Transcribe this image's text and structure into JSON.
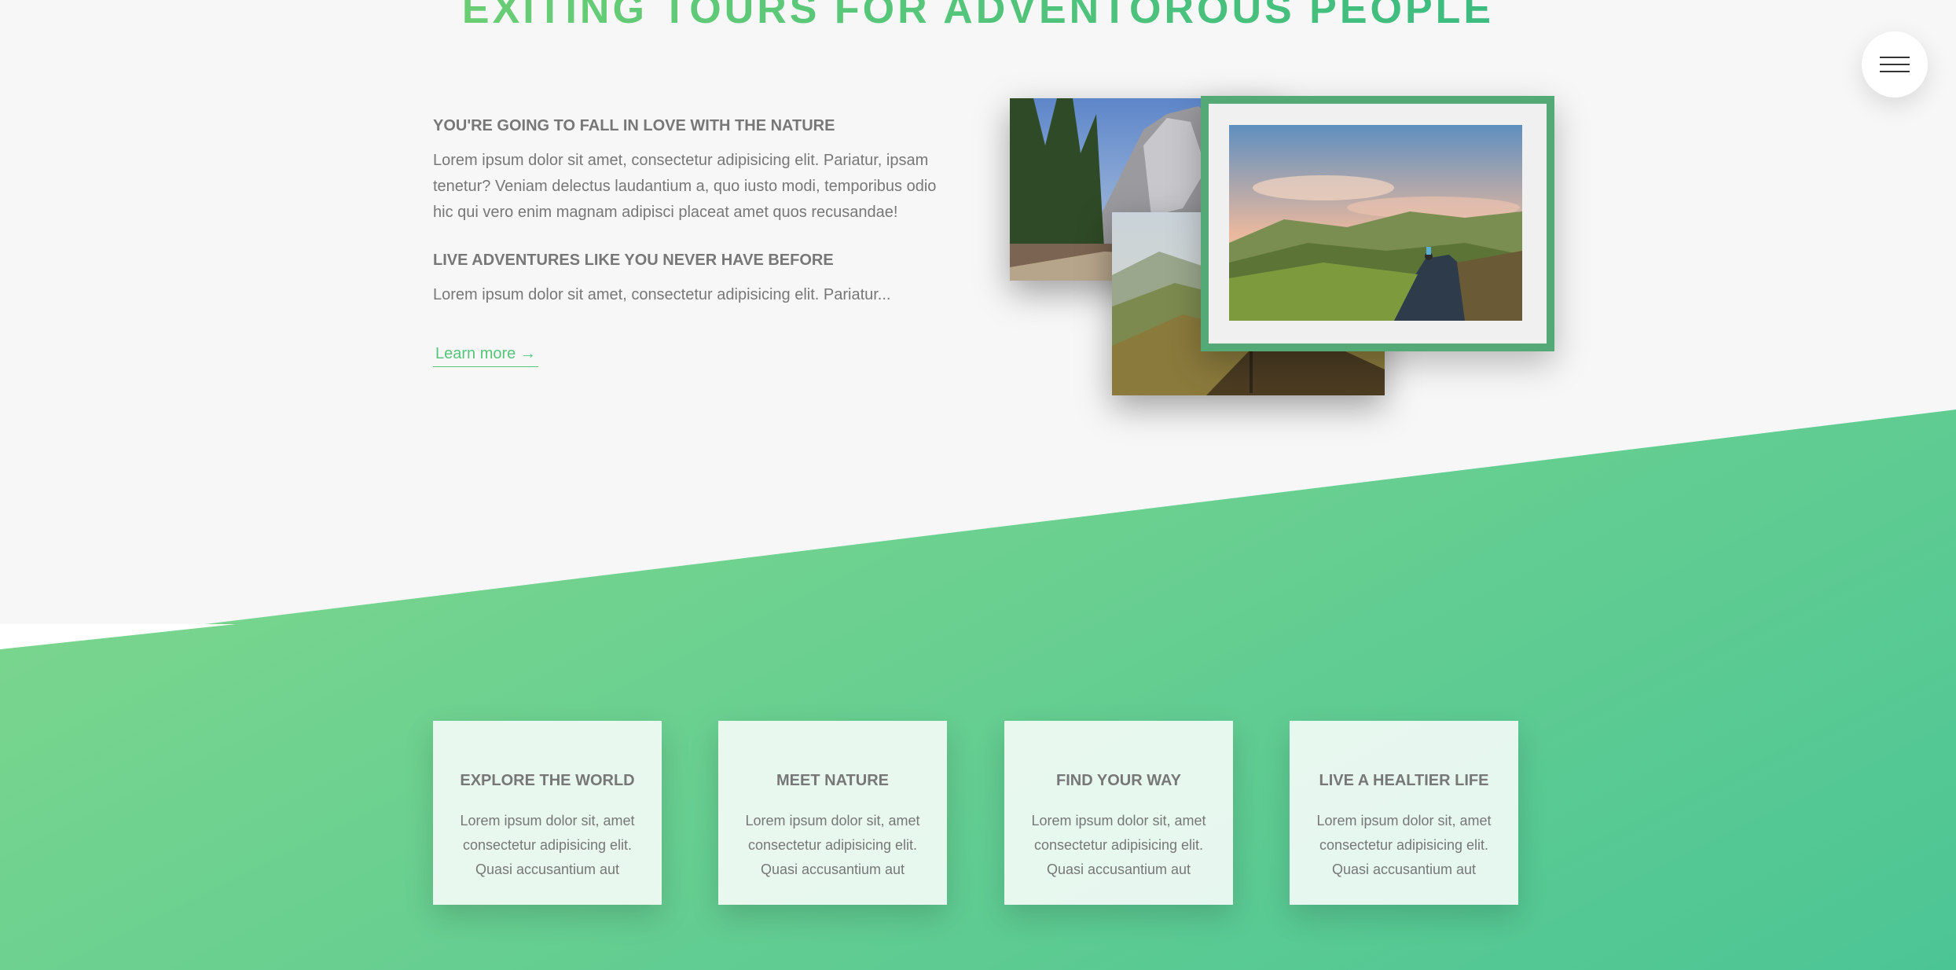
{
  "about": {
    "heading": "EXITING TOURS FOR ADVENTOROUS PEOPLE",
    "block1_title": "YOU'RE GOING TO FALL IN LOVE WITH THE NATURE",
    "block1_text": "Lorem ipsum dolor sit amet, consectetur adipisicing elit. Pariatur, ipsam tenetur? Veniam delectus laudantium a, quo iusto modi, temporibus odio hic qui vero enim magnam adipisci placeat amet quos recusandae!",
    "block2_title": "LIVE ADVENTURES LIKE YOU NEVER HAVE BEFORE",
    "block2_text": "Lorem ipsum dolor sit amet, consectetur adipisicing elit. Pariatur...",
    "learn_more": "Learn more →"
  },
  "features": [
    {
      "title": "EXPLORE THE WORLD",
      "text": "Lorem ipsum dolor sit, amet consectetur adipisicing elit. Quasi accusantium aut"
    },
    {
      "title": "MEET NATURE",
      "text": "Lorem ipsum dolor sit, amet consectetur adipisicing elit. Quasi accusantium aut"
    },
    {
      "title": "FIND YOUR WAY",
      "text": "Lorem ipsum dolor sit, amet consectetur adipisicing elit. Quasi accusantium aut"
    },
    {
      "title": "LIVE A HEALTIER LIFE",
      "text": "Lorem ipsum dolor sit, amet consectetur adipisicing elit. Quasi accusantium aut"
    }
  ],
  "colors": {
    "primary_light": "#7ed56f",
    "primary_dark": "#28b485",
    "frame": "#55a977"
  },
  "icons": {
    "menu": "hamburger-menu-icon"
  }
}
